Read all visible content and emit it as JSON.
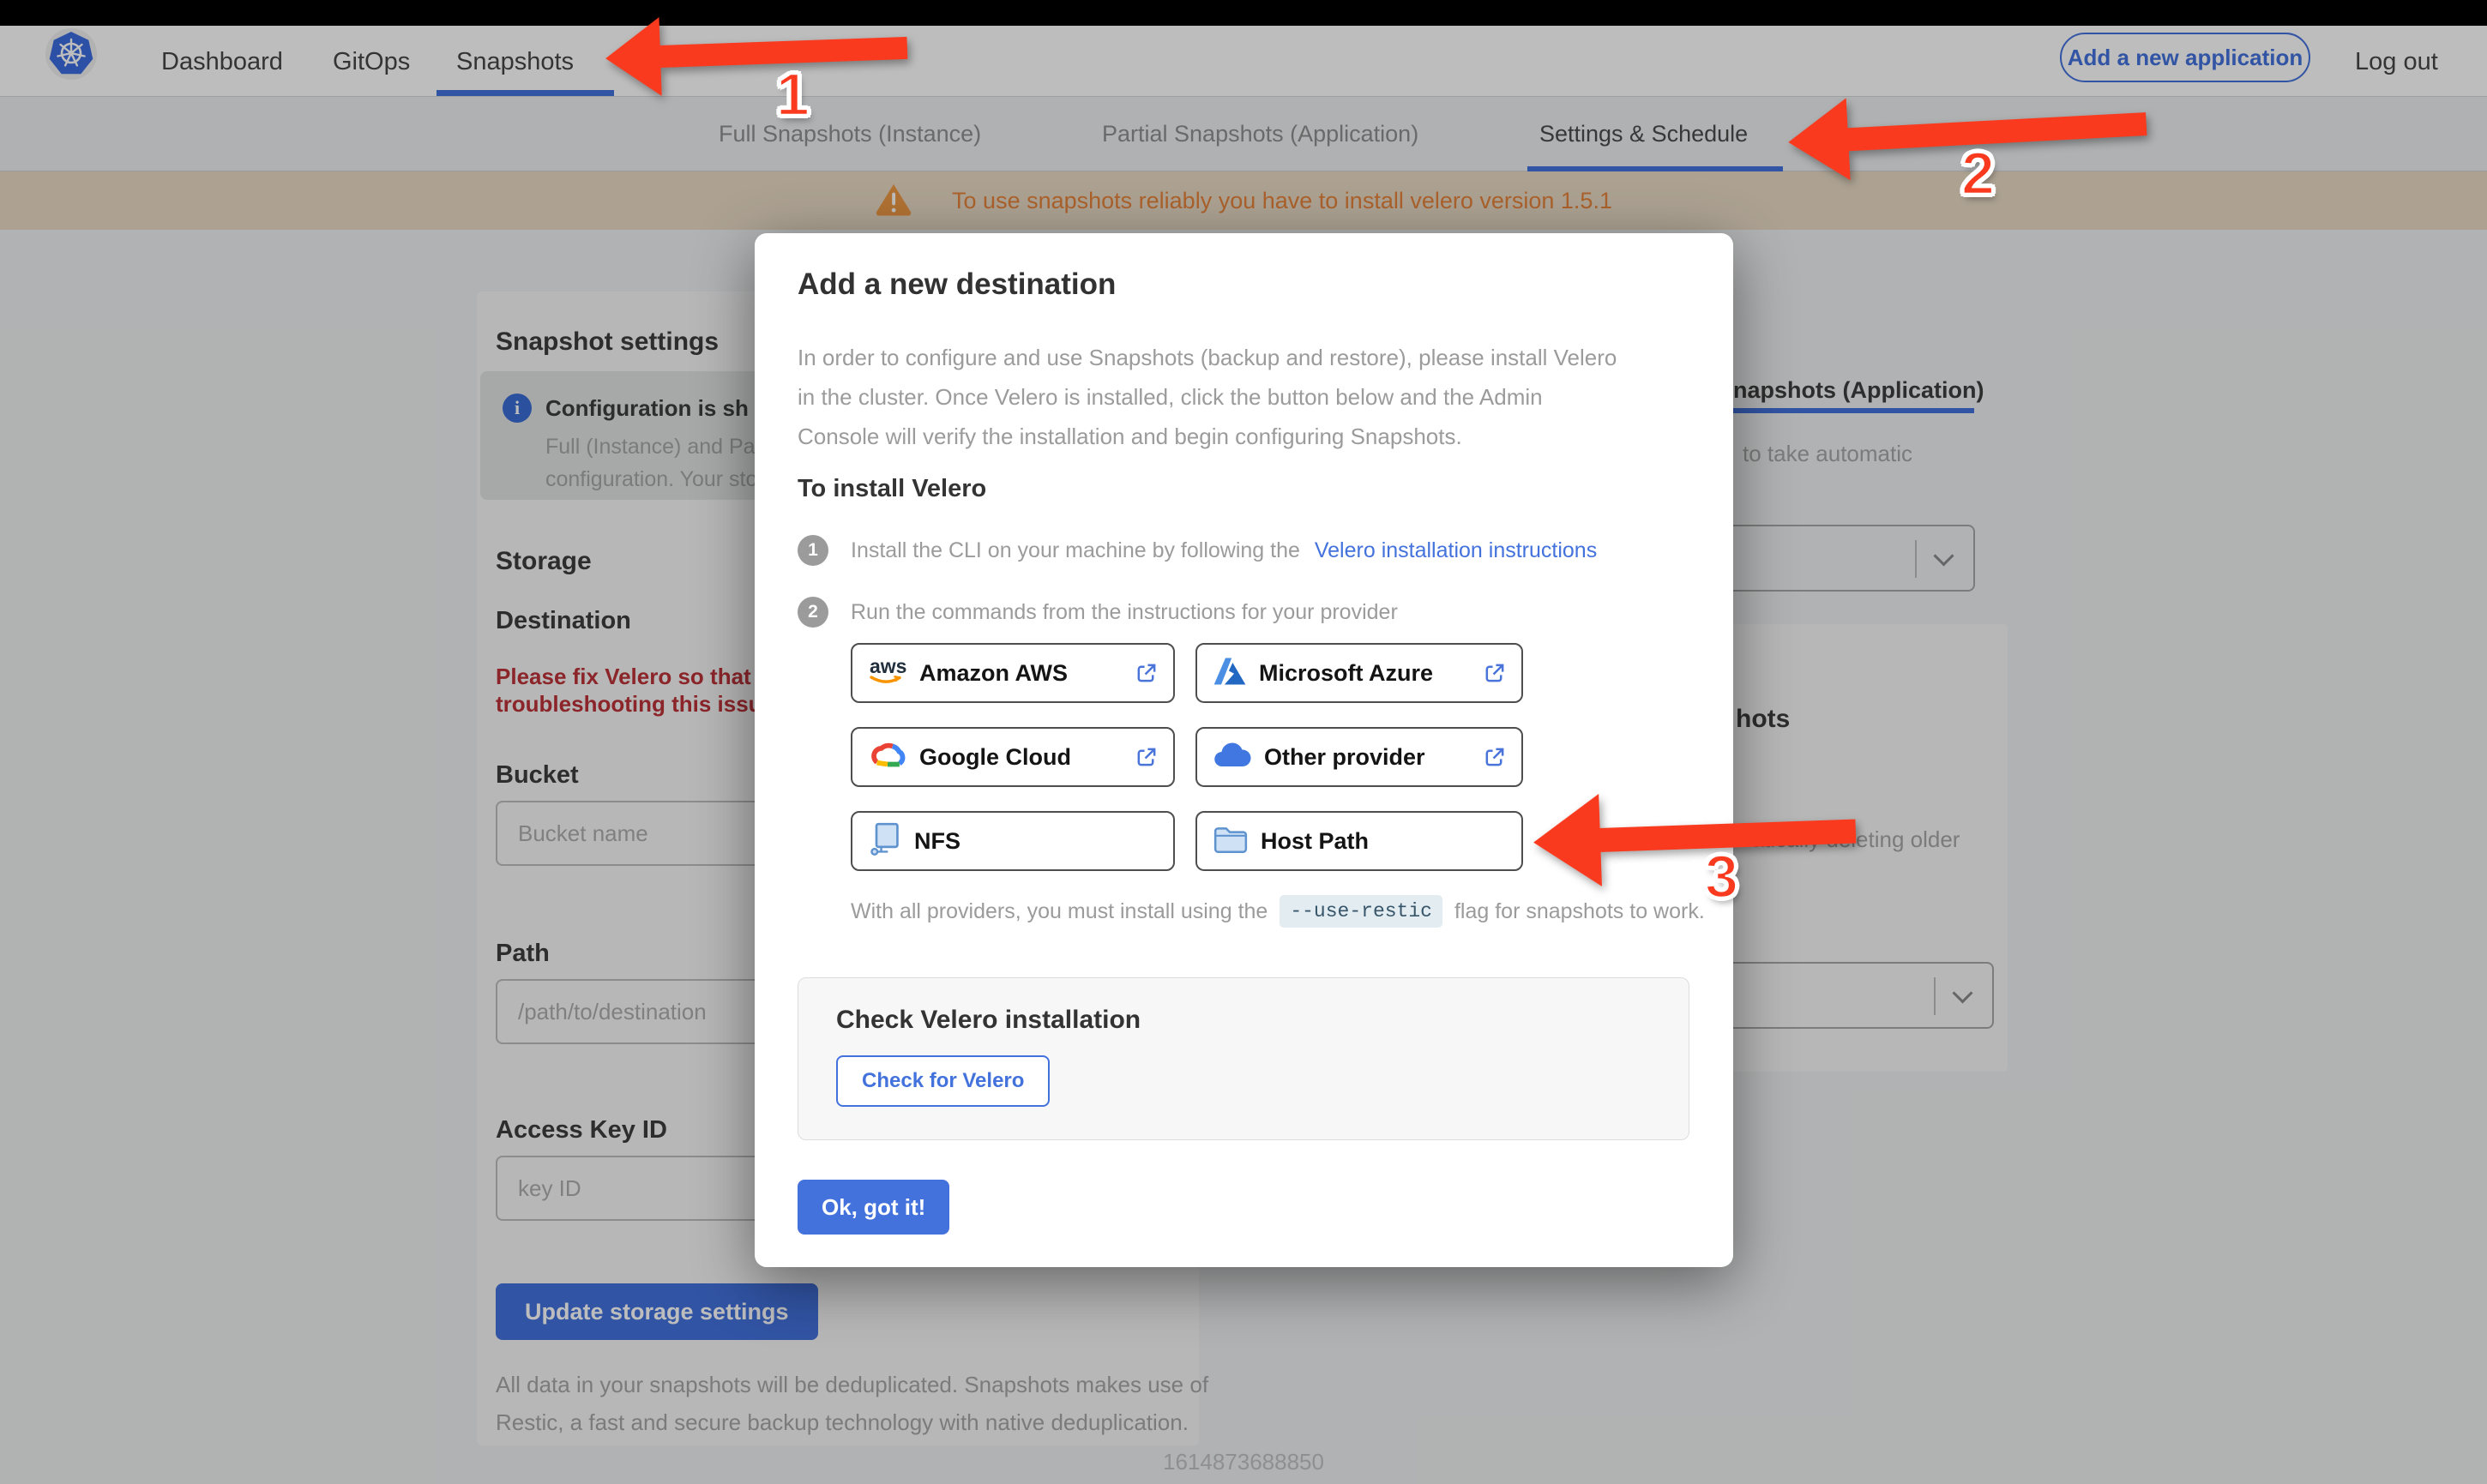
{
  "colors": {
    "accent": "#4372dd",
    "arrow_red": "#fa3a1e",
    "banner_text": "#e8853c"
  },
  "topnav": {
    "items": [
      "Dashboard",
      "GitOps",
      "Snapshots"
    ],
    "active": "Snapshots",
    "add_app_button": "Add a new application",
    "logout": "Log out"
  },
  "subnav": {
    "tabs": [
      "Full Snapshots (Instance)",
      "Partial Snapshots (Application)",
      "Settings & Schedule"
    ],
    "active": "Settings & Schedule"
  },
  "banner": {
    "text": "To use snapshots reliably you have to install velero version 1.5.1"
  },
  "settings_page": {
    "heading": "Snapshot settings",
    "info_title": "Configuration is sh",
    "info_line1": "Full (Instance) and Parti",
    "info_line2": "configuration. Your stor",
    "storage_heading": "Storage",
    "destination_heading": "Destination",
    "error_line1": "Please fix Velero so that th",
    "error_line2": "troubleshooting this issue",
    "bucket_label": "Bucket",
    "bucket_placeholder": "Bucket name",
    "path_label": "Path",
    "path_placeholder": "/path/to/destination",
    "access_key_label": "Access Key ID",
    "access_key_placeholder": "key ID",
    "update_button": "Update storage settings",
    "dedup_line1": "All data in your snapshots will be deduplicated. Snapshots makes use of",
    "dedup_line2": "Restic, a fast and secure backup technology with native deduplication."
  },
  "right_page": {
    "tab_fragment": "napshots (Application)",
    "auto_fragment": "to take automatic",
    "heading_fragment": "hots",
    "deleting_fragment": "matically deleting older"
  },
  "modal": {
    "title": "Add a new destination",
    "intro": "In order to configure and use Snapshots (backup and restore), please install Velero in the cluster. Once Velero is installed, click the button below and the Admin Console will verify the installation and begin configuring Snapshots.",
    "install_heading": "To install Velero",
    "step1": {
      "num": "1",
      "text": "Install the CLI on your machine by following the",
      "link": "Velero installation instructions"
    },
    "step2": {
      "num": "2",
      "text": "Run the commands from the instructions for your provider"
    },
    "providers": [
      {
        "label": "Amazon AWS",
        "icon": "aws-icon",
        "external": true
      },
      {
        "label": "Microsoft Azure",
        "icon": "azure-icon",
        "external": true
      },
      {
        "label": "Google Cloud",
        "icon": "google-cloud-icon",
        "external": true
      },
      {
        "label": "Other provider",
        "icon": "cloud-icon",
        "external": true
      },
      {
        "label": "NFS",
        "icon": "nfs-icon",
        "external": false
      },
      {
        "label": "Host Path",
        "icon": "folder-icon",
        "external": false
      }
    ],
    "restic_pre": "With all providers, you must install using the",
    "restic_code": "--use-restic",
    "restic_post": "flag for snapshots to work.",
    "check_title": "Check Velero installation",
    "check_button": "Check for Velero",
    "ok_button": "Ok, got it!"
  },
  "annotations": {
    "n1": "1",
    "n2": "2",
    "n3": "3"
  },
  "footer": {
    "timestamp": "1614873688850"
  }
}
